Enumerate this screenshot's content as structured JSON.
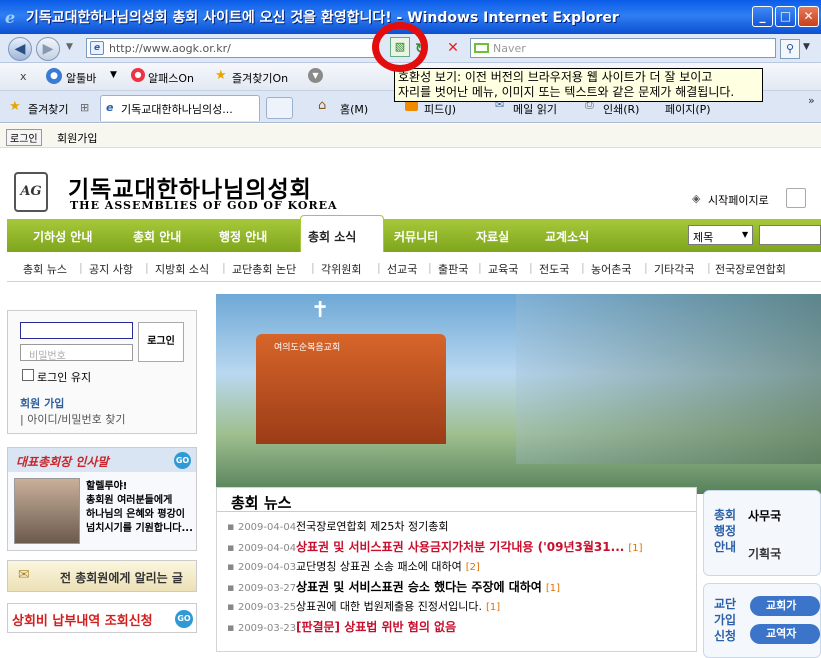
{
  "window": {
    "title": "기독교대한하나님의성회 총회 사이트에 오신 것을 환영합니다! - Windows Internet Explorer",
    "min": "_",
    "max": "□",
    "close": "✕"
  },
  "nav": {
    "url": "http://www.aogk.or.kr/",
    "search_placeholder": "Naver"
  },
  "links": {
    "close": "x",
    "allebar": "알툴바",
    "alpass": "알패스On",
    "favon": "즐겨찾기On"
  },
  "tabs": {
    "favorites": "즐겨찾기",
    "tab1": "기독교대한하나님의성...",
    "home": "홈(M)",
    "feed": "피드(J)",
    "mail": "메일 읽기",
    "print": "인쇄(R)",
    "page": "페이지(P)"
  },
  "tooltip": {
    "line1": "호환성 보기: 이전 버전의 브라우저용 웹 사이트가 더 잘 보이고",
    "line2": "자리를 벗어난 메뉴, 이미지 또는 텍스트와 같은 문제가 해결됩니다."
  },
  "site": {
    "login_link": "로그인",
    "join_link": "회원가입",
    "name_kr": "기독교대한하나님의성회",
    "name_en": "THE ASSEMBLIES OF GOD OF KOREA",
    "logo_mark": "AG",
    "startpage": "시작페이지로",
    "menu": [
      "기하성 안내",
      "총회 안내",
      "행정 안내",
      "총회 소식",
      "커뮤니티",
      "자료실",
      "교계소식"
    ],
    "search_select": "제목",
    "submenu": [
      "총회 뉴스",
      "공지 사항",
      "지방회 소식",
      "교단총회 논단",
      "각위원회",
      "선교국",
      "출판국",
      "교육국",
      "전도국",
      "농어촌국",
      "기타각국",
      "전국장로연합회"
    ],
    "login": {
      "id_placeholder": "",
      "pw_placeholder": "비밀번호",
      "button": "로그인",
      "keep": "로그인 유지",
      "join": "회원 가입",
      "find": "아이디/비밀번호 찾기"
    },
    "greeting": {
      "title": "대표총회장 인사말",
      "go": "GO",
      "text1": "할렐루야!",
      "text2": "총회원 여러분들에게",
      "text3": "하나님의 은혜와 평강이",
      "text4": "넘치시기를 기원합니다..."
    },
    "notice_banner": "전 총회원에게 알리는 글",
    "fee_banner": "상회비 납부내역 조회신청",
    "fee_go": "GO",
    "banner_church": "여의도순복음교회",
    "news_title": "총회 뉴스",
    "news": [
      {
        "date": "2009-04-04",
        "title": "전국장로연합회 제25차 정기총회",
        "badge": "",
        "red": false,
        "bold": false
      },
      {
        "date": "2009-04-04",
        "title": "상표권 및 서비스표권 사용금지가처분 기각내용 ('09년3월31...",
        "badge": "[1]",
        "red": true,
        "bold": true
      },
      {
        "date": "2009-04-03",
        "title": "교단명칭 상표권 소송 패소에 대하여",
        "badge": "[2]",
        "red": false,
        "bold": false
      },
      {
        "date": "2009-03-27",
        "title": "상표권 및 서비스표권 승소 했다는 주장에 대하여",
        "badge": "[1]",
        "red": false,
        "bold": true
      },
      {
        "date": "2009-03-25",
        "title": "상표권에 대한 법원제출용 진정서입니다.",
        "badge": "[1]",
        "red": false,
        "bold": false
      },
      {
        "date": "2009-03-23",
        "title": "[판결문] 상표법 위반 혐의 없음",
        "badge": "",
        "red": true,
        "bold": true
      }
    ],
    "right1_title": "총회행정안내",
    "right1_a": "사무국",
    "right1_b": "기획국",
    "right2_title": "교단가입신청",
    "right2_a": "교회가",
    "right2_b": "교역자"
  }
}
